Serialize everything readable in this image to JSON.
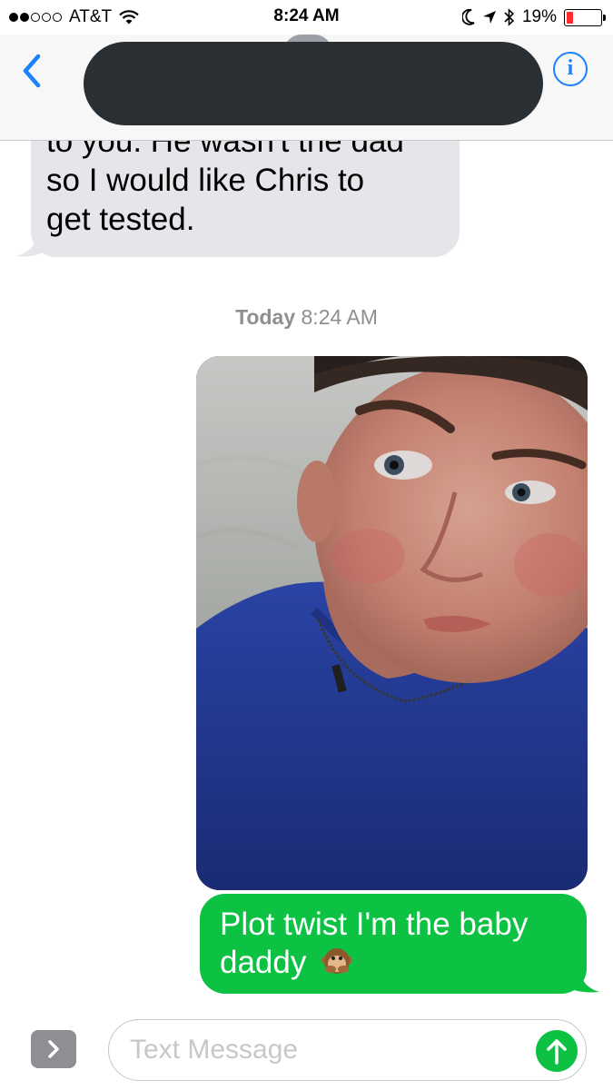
{
  "status_bar": {
    "carrier": "AT&T",
    "time": "8:24 AM",
    "battery_percent": "19%",
    "battery_level": 0.19,
    "battery_color": "#ff2d2d",
    "icons": [
      "signal-dots-icon",
      "wifi-icon",
      "moon-icon",
      "location-arrow-icon",
      "bluetooth-icon",
      "battery-icon"
    ]
  },
  "nav": {
    "back_icon": "chevron-left-icon",
    "contact_redacted": true,
    "info_label": "i",
    "accent_color": "#1a82fb"
  },
  "messages": {
    "incoming": {
      "lines": [
        "to you. He wasn't the dad",
        "so I would like Chris to",
        "get tested."
      ]
    },
    "timestamp": {
      "day": "Today",
      "time": "8:24 AM"
    },
    "outgoing_photo": {
      "kind": "selfie-photo"
    },
    "outgoing": {
      "text": "Plot twist I'm the baby daddy",
      "emoji": "speak-no-evil-monkey-icon",
      "bubble_color": "#0dc143"
    }
  },
  "input_bar": {
    "apps_icon": "chevron-right-icon",
    "placeholder": "Text Message",
    "send_icon": "arrow-up-icon"
  }
}
